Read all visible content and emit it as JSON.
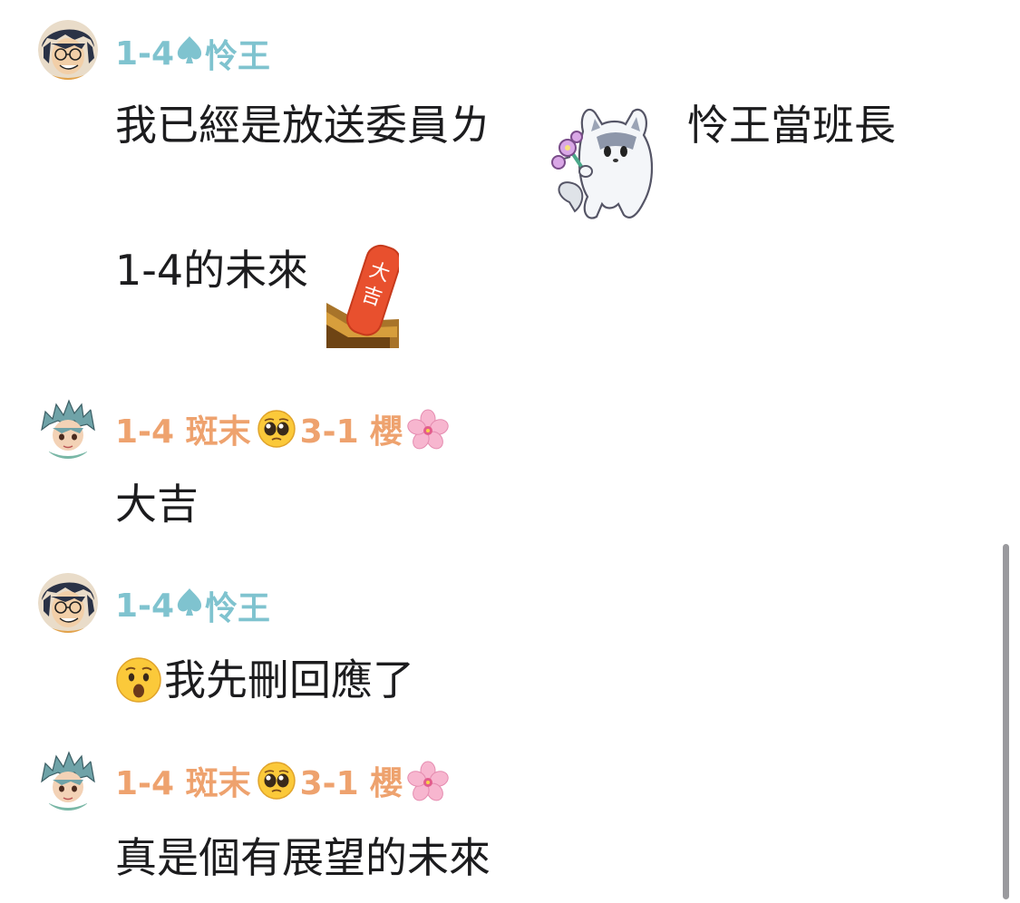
{
  "messages": [
    {
      "author": {
        "prefix": "1-4",
        "icon": "spade-icon",
        "name": "怜王"
      },
      "lines": [
        {
          "before": "我已經是放送委員ㄌ",
          "sticker": "wolf-flower-sticker",
          "after": "怜王當班長"
        },
        {
          "before": "1-4的未來",
          "sticker": "omikuji-daikichi-sticker",
          "sticker_text": "大吉"
        }
      ]
    },
    {
      "author": {
        "prefix": "1-4 斑末",
        "icon": "pleading-face-emoji",
        "suffix": "3-1 櫻",
        "suffix_icon": "cherry-blossom-emoji"
      },
      "text": "大吉"
    },
    {
      "author": {
        "prefix": "1-4",
        "icon": "spade-icon",
        "name": "怜王"
      },
      "text_icon": "hushed-face-emoji",
      "text": "我先刪回應了"
    },
    {
      "author": {
        "prefix": "1-4 斑末",
        "icon": "pleading-face-emoji",
        "suffix": "3-1 櫻",
        "suffix_icon": "cherry-blossom-emoji"
      },
      "text": "真是個有展望的未來"
    }
  ],
  "colors": {
    "author_teal": "#7fc3cf",
    "author_orange": "#eea26e",
    "text": "#1c1c1e",
    "scrollbar": "#9a9a9e"
  }
}
